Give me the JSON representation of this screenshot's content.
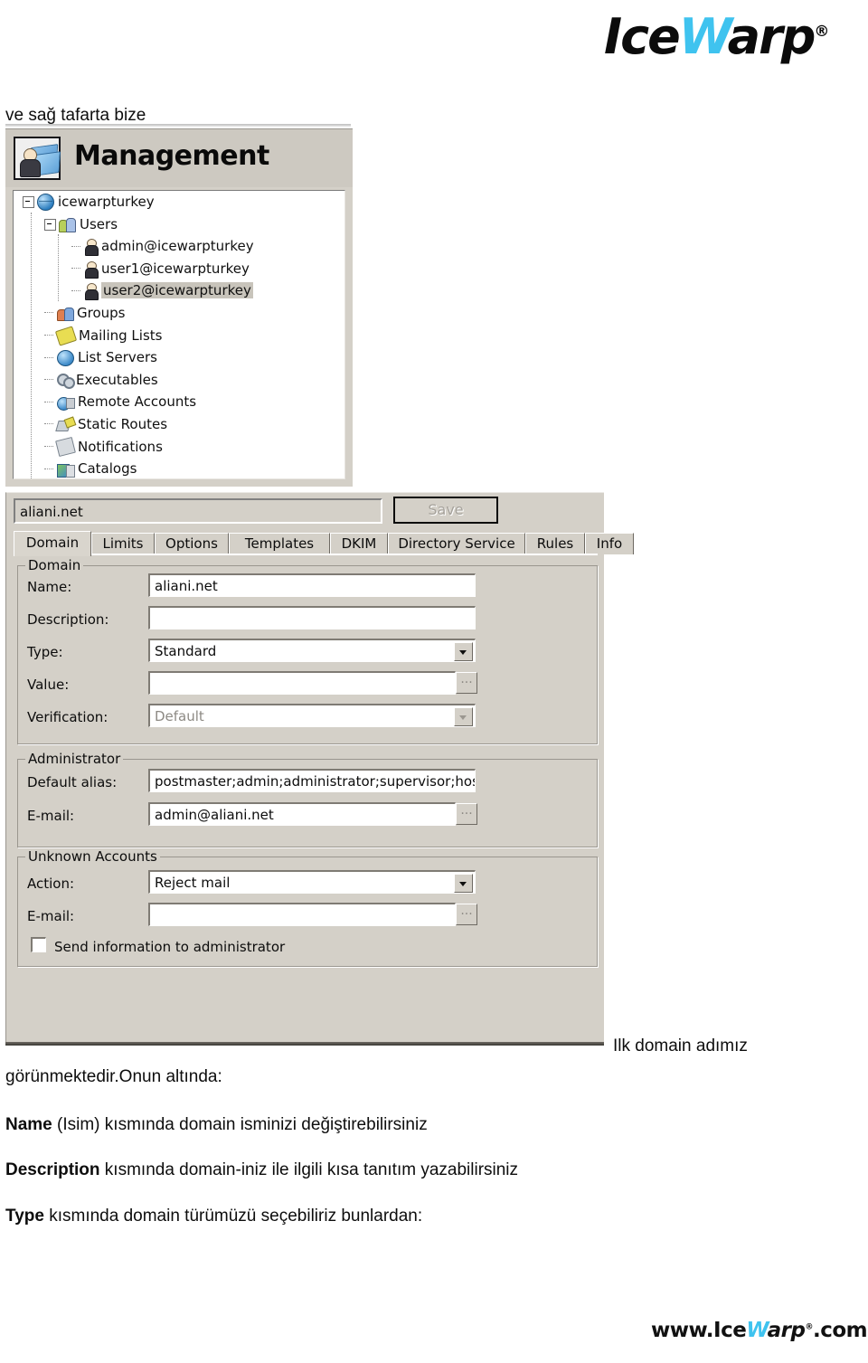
{
  "brand": {
    "logo_pre": "Ice",
    "logo_w": "W",
    "logo_post": "arp",
    "registered": "®",
    "accent_color": "#3fc3ef",
    "footer_pre": "www.Ice",
    "footer_w": "W",
    "footer_post": "arp",
    "footer_tld": ".com.tr"
  },
  "prose": {
    "intro": "ve sağ tafarta bize",
    "caption_right": "Ilk domain adımız",
    "line1": "görünmektedir.Onun altında:",
    "line2_bold": "Name",
    "line2_rest": " (Isim) kısmında domain isminizi değiştirebilirsiniz",
    "line3_bold": "Description",
    "line3_rest": " kısmında domain-iniz ile ilgili kısa tanıtım yazabilirsiniz",
    "line4_bold": "Type",
    "line4_rest": " kısmında domain türümüzü seçebiliriz bunlardan:"
  },
  "management": {
    "title": "Management",
    "tree": [
      {
        "label": "icewarpturkey",
        "icon": "globe-icon",
        "depth": 0,
        "expander": "minus",
        "selected": false
      },
      {
        "label": "Users",
        "icon": "users-icon",
        "depth": 1,
        "expander": "minus",
        "selected": false
      },
      {
        "label": "admin@icewarpturkey",
        "icon": "person-icon",
        "depth": 2,
        "expander": "none",
        "selected": false
      },
      {
        "label": "user1@icewarpturkey",
        "icon": "person-icon",
        "depth": 2,
        "expander": "none",
        "selected": false
      },
      {
        "label": "user2@icewarpturkey",
        "icon": "person-icon",
        "depth": 2,
        "expander": "none",
        "selected": true
      },
      {
        "label": "Groups",
        "icon": "groups-icon",
        "depth": 1,
        "expander": "none",
        "selected": false
      },
      {
        "label": "Mailing Lists",
        "icon": "mail-icon",
        "depth": 1,
        "expander": "none",
        "selected": false
      },
      {
        "label": "List Servers",
        "icon": "listsrv-icon",
        "depth": 1,
        "expander": "none",
        "selected": false
      },
      {
        "label": "Executables",
        "icon": "exec-icon",
        "depth": 1,
        "expander": "none",
        "selected": false
      },
      {
        "label": "Remote Accounts",
        "icon": "remote-icon",
        "depth": 1,
        "expander": "none",
        "selected": false
      },
      {
        "label": "Static Routes",
        "icon": "static-icon",
        "depth": 1,
        "expander": "none",
        "selected": false
      },
      {
        "label": "Notifications",
        "icon": "notif-icon",
        "depth": 1,
        "expander": "none",
        "selected": false
      },
      {
        "label": "Catalogs",
        "icon": "catalog-icon",
        "depth": 1,
        "expander": "none",
        "selected": false
      }
    ]
  },
  "domain_window": {
    "name_bar_value": "aliani.net",
    "save_label": "Save",
    "save_enabled": false,
    "tabs": [
      {
        "label": "Domain",
        "active": true
      },
      {
        "label": "Limits",
        "active": false
      },
      {
        "label": "Options",
        "active": false
      },
      {
        "label": "Templates",
        "active": false
      },
      {
        "label": "DKIM",
        "active": false
      },
      {
        "label": "Directory Service",
        "active": false
      },
      {
        "label": "Rules",
        "active": false
      },
      {
        "label": "Info",
        "active": false
      }
    ],
    "domain_group": {
      "title": "Domain",
      "name_label": "Name:",
      "name_value": "aliani.net",
      "description_label": "Description:",
      "description_value": "",
      "type_label": "Type:",
      "type_value": "Standard",
      "value_label": "Value:",
      "value_value": "",
      "verification_label": "Verification:",
      "verification_value": "Default",
      "browse_label": "..."
    },
    "administrator_group": {
      "title": "Administrator",
      "default_alias_label": "Default alias:",
      "default_alias_value": "postmaster;admin;administrator;supervisor;hostma",
      "email_label": "E-mail:",
      "email_value": "admin@aliani.net",
      "browse_label": "..."
    },
    "unknown_accounts_group": {
      "title": "Unknown Accounts",
      "action_label": "Action:",
      "action_value": "Reject mail",
      "email_label": "E-mail:",
      "email_value": "",
      "browse_label": "...",
      "send_info_label": "Send information to administrator",
      "send_info_checked": false
    }
  }
}
